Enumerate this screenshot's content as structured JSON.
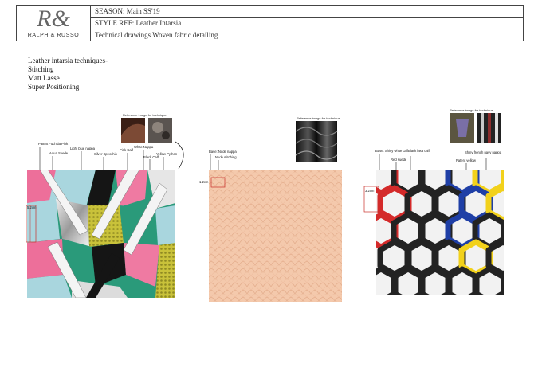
{
  "header": {
    "logo_monogram": "R&",
    "logo_text": "RALPH & RUSSO",
    "season": "SEASON: Main SS'19",
    "style_ref": "STYLE REF: Leather Intarsia",
    "description": "Technical drawings Woven fabric detailing"
  },
  "notes": {
    "title": "Leather intarsia techniques-",
    "items": [
      "Stitching",
      "Matt Lasse",
      "Super Positioning"
    ]
  },
  "panel1": {
    "reference_caption": "Reference image for technique",
    "labels": [
      "Patent Fuchsia Pink",
      "Aqua Suede",
      "Light blue nappa",
      "Silver Specchio",
      "Pink Calf",
      "White Nappa",
      "Black Calf",
      "Yellow Python"
    ],
    "measure": "5.2cm"
  },
  "panel2": {
    "reference_caption": "Reference image for technique",
    "labels": [
      "Base: Nude nappa",
      "Nude stitching"
    ],
    "measure": "1.2cm"
  },
  "panel3": {
    "reference_caption": "Reference image for technique",
    "labels": [
      "Base: Shiny white calf",
      "Black lasa calf",
      "Red suede",
      "Patent yellow",
      "Shiny french navy nappa"
    ],
    "measure": "3.2cm"
  }
}
